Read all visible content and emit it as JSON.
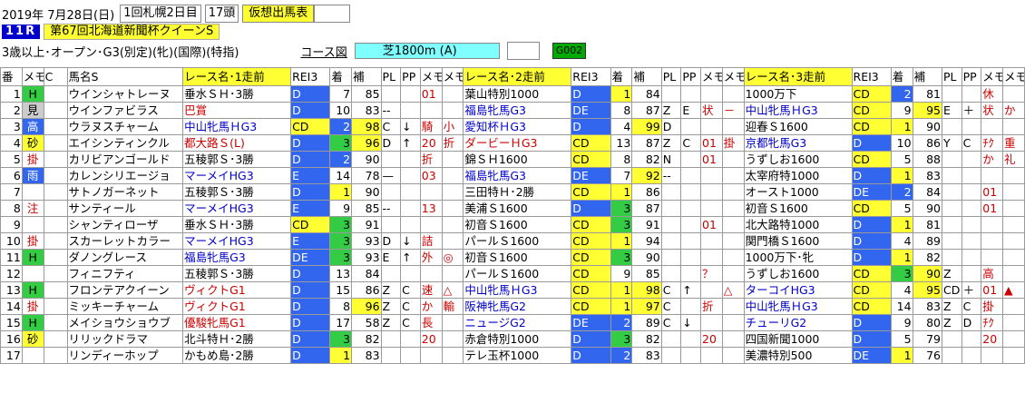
{
  "header": {
    "date": "2019年 7月28日(日)",
    "meet": "1回札幌2日目",
    "runners": "17頭",
    "status_label": "仮想出馬表",
    "race_no": "11R",
    "race_name": "第67回北海道新聞杯クイーンS",
    "conditions": "3歳以上･オープン･G3(別定)(牝)(国際)(特指)",
    "course_label": "コース図",
    "course": "芝1800m (A)",
    "code": "G002"
  },
  "columns": {
    "num": "番",
    "memo": "メモ",
    "c": "C",
    "name": "馬名S",
    "race1": "レース名･1走前",
    "rank3": "REI3",
    "place": "着",
    "supp": "補",
    "pl": "PL",
    "pp": "PP",
    "race2": "レース名･2走前",
    "race3": "レース名･3走前"
  },
  "rows": [
    {
      "no": "1",
      "mark": "H",
      "mc": "grn",
      "name": "ウインシャトレーヌ",
      "r1": "垂水ＳＨ･3勝",
      "r1c": "",
      "g1": "D",
      "g1c": "blue",
      "p1": "7",
      "p1c": "",
      "s1": "85",
      "s1c": "",
      "pl1": "",
      "pp1": "",
      "m1a": "01",
      "m1b": "",
      "r2": "葉山特別1000",
      "r2c": "",
      "g2": "D",
      "g2c": "blue",
      "p2": "1",
      "p2c": "yel",
      "s2": "84",
      "s2c": "",
      "pl2": "",
      "pp2": "",
      "m2a": "",
      "m2b": "",
      "r3": "1000万下",
      "r3c": "",
      "g3": "CD",
      "g3c": "yel",
      "p3": "2",
      "p3c": "blue",
      "s3": "81",
      "s3c": "",
      "pl3": "",
      "pp3": "",
      "m3a": "休",
      "m3b": ""
    },
    {
      "no": "2",
      "mark": "見",
      "mc": "gray",
      "name": "ウインファビラス",
      "r1": "巴賞",
      "r1c": "red",
      "g1": "D",
      "g1c": "blue",
      "p1": "10",
      "p1c": "",
      "s1": "83",
      "s1c": "",
      "pl1": "--",
      "pp1": "",
      "m1a": "",
      "m1b": "",
      "r2": "福島牝馬G3",
      "r2c": "dblue",
      "g2": "DE",
      "g2c": "blue",
      "p2": "8",
      "p2c": "",
      "s2": "87",
      "s2c": "",
      "pl2": "Z",
      "pp2": "E",
      "m2a": "状",
      "m2b": "－",
      "r3": "中山牝馬ＨG3",
      "r3c": "dblue",
      "g3": "CD",
      "g3c": "yel",
      "p3": "9",
      "p3c": "",
      "s3": "95",
      "s3c": "yel",
      "pl3": "E",
      "pp3": "＋",
      "m3a": "状",
      "m3b": "か"
    },
    {
      "no": "3",
      "mark": "高",
      "mc": "blue",
      "name": "ウラヌスチャーム",
      "r1": "中山牝馬ＨG3",
      "r1c": "dblue",
      "g1": "CD",
      "g1c": "yel",
      "p1": "2",
      "p1c": "blue",
      "s1": "98",
      "s1c": "yel",
      "pl1": "C",
      "pp1": "↓",
      "m1a": "騎",
      "m1b": "小",
      "r2": "愛知杯ＨG3",
      "r2c": "dblue",
      "g2": "D",
      "g2c": "blue",
      "p2": "4",
      "p2c": "",
      "s2": "99",
      "s2c": "yel",
      "pl2": "D",
      "pp2": "",
      "m2a": "",
      "m2b": "",
      "r3": "迎春Ｓ1600",
      "r3c": "",
      "g3": "CD",
      "g3c": "yel",
      "p3": "1",
      "p3c": "yel",
      "s3": "90",
      "s3c": "",
      "pl3": "",
      "pp3": "",
      "m3a": "",
      "m3b": ""
    },
    {
      "no": "4",
      "mark": "砂",
      "mc": "yel",
      "name": "エイシンティンクル",
      "r1": "都大路Ｓ(L)",
      "r1c": "red",
      "g1": "D",
      "g1c": "blue",
      "p1": "3",
      "p1c": "grn",
      "s1": "96",
      "s1c": "yel",
      "pl1": "D",
      "pp1": "↑",
      "m1a": "20",
      "m1b": "折",
      "r2": "ダービーＨG3",
      "r2c": "red",
      "g2": "CD",
      "g2c": "yel",
      "p2": "13",
      "p2c": "",
      "s2": "87",
      "s2c": "",
      "pl2": "Z",
      "pp2": "C",
      "m2a": "01",
      "m2b": "掛",
      "r3": "京都牝馬G3",
      "r3c": "dblue",
      "g3": "D",
      "g3c": "blue",
      "p3": "10",
      "p3c": "",
      "s3": "86",
      "s3c": "",
      "pl3": "Y",
      "pp3": "C",
      "m3a": "ﾁｸ",
      "m3b": "重"
    },
    {
      "no": "5",
      "mark": "掛",
      "mc": "red",
      "name": "カリビアンゴールド",
      "r1": "五稜郭Ｓ･3勝",
      "r1c": "",
      "g1": "D",
      "g1c": "blue",
      "p1": "2",
      "p1c": "blue",
      "s1": "90",
      "s1c": "",
      "pl1": "",
      "pp1": "",
      "m1a": "折",
      "m1b": "",
      "r2": "錦ＳＨ1600",
      "r2c": "",
      "g2": "CD",
      "g2c": "yel",
      "p2": "8",
      "p2c": "",
      "s2": "82",
      "s2c": "",
      "pl2": "N",
      "pp2": "",
      "m2a": "01",
      "m2b": "",
      "r3": "うずしお1600",
      "r3c": "",
      "g3": "CD",
      "g3c": "yel",
      "p3": "5",
      "p3c": "",
      "s3": "88",
      "s3c": "",
      "pl3": "",
      "pp3": "",
      "m3a": "か",
      "m3b": "礼"
    },
    {
      "no": "6",
      "mark": "雨",
      "mc": "blue",
      "name": "カレンシリエージョ",
      "r1": "マーメイHG3",
      "r1c": "dblue",
      "g1": "E",
      "g1c": "blue",
      "p1": "14",
      "p1c": "",
      "s1": "78",
      "s1c": "",
      "pl1": "—",
      "pp1": "",
      "m1a": "03",
      "m1b": "",
      "r2": "福島牝馬G3",
      "r2c": "dblue",
      "g2": "DE",
      "g2c": "blue",
      "p2": "7",
      "p2c": "",
      "s2": "92",
      "s2c": "yel",
      "pl2": "--",
      "pp2": "",
      "m2a": "",
      "m2b": "",
      "r3": "太宰府特1000",
      "r3c": "",
      "g3": "D",
      "g3c": "blue",
      "p3": "1",
      "p3c": "yel",
      "s3": "83",
      "s3c": "",
      "pl3": "",
      "pp3": "",
      "m3a": "",
      "m3b": ""
    },
    {
      "no": "7",
      "mark": "",
      "mc": "",
      "name": "サトノガーネット",
      "r1": "五稜郭Ｓ･3勝",
      "r1c": "",
      "g1": "D",
      "g1c": "blue",
      "p1": "1",
      "p1c": "yel",
      "s1": "90",
      "s1c": "",
      "pl1": "",
      "pp1": "",
      "m1a": "",
      "m1b": "",
      "r2": "三田特Ｈ･2勝",
      "r2c": "",
      "g2": "CD",
      "g2c": "yel",
      "p2": "1",
      "p2c": "yel",
      "s2": "86",
      "s2c": "",
      "pl2": "",
      "pp2": "",
      "m2a": "",
      "m2b": "",
      "r3": "オースト1000",
      "r3c": "",
      "g3": "DE",
      "g3c": "blue",
      "p3": "2",
      "p3c": "blue",
      "s3": "84",
      "s3c": "",
      "pl3": "",
      "pp3": "",
      "m3a": "01",
      "m3b": ""
    },
    {
      "no": "8",
      "mark": "注",
      "mc": "red",
      "name": "サンティール",
      "r1": "マーメイHG3",
      "r1c": "dblue",
      "g1": "E",
      "g1c": "blue",
      "p1": "9",
      "p1c": "",
      "s1": "85",
      "s1c": "",
      "pl1": "--",
      "pp1": "",
      "m1a": "13",
      "m1b": "",
      "r2": "美浦Ｓ1600",
      "r2c": "",
      "g2": "D",
      "g2c": "blue",
      "p2": "3",
      "p2c": "grn",
      "s2": "87",
      "s2c": "",
      "pl2": "",
      "pp2": "",
      "m2a": "",
      "m2b": "",
      "r3": "初音Ｓ1600",
      "r3c": "",
      "g3": "CD",
      "g3c": "yel",
      "p3": "5",
      "p3c": "",
      "s3": "90",
      "s3c": "",
      "pl3": "",
      "pp3": "",
      "m3a": "01",
      "m3b": ""
    },
    {
      "no": "9",
      "mark": "",
      "mc": "",
      "name": "シャンティローザ",
      "r1": "垂水ＳＨ･3勝",
      "r1c": "",
      "g1": "CD",
      "g1c": "yel",
      "p1": "3",
      "p1c": "grn",
      "s1": "91",
      "s1c": "",
      "pl1": "",
      "pp1": "",
      "m1a": "",
      "m1b": "",
      "r2": "初音Ｓ1600",
      "r2c": "",
      "g2": "CD",
      "g2c": "yel",
      "p2": "3",
      "p2c": "grn",
      "s2": "91",
      "s2c": "",
      "pl2": "",
      "pp2": "",
      "m2a": "01",
      "m2b": "",
      "r3": "北大路特1000",
      "r3c": "",
      "g3": "D",
      "g3c": "blue",
      "p3": "1",
      "p3c": "yel",
      "s3": "81",
      "s3c": "",
      "pl3": "",
      "pp3": "",
      "m3a": "",
      "m3b": ""
    },
    {
      "no": "10",
      "mark": "掛",
      "mc": "red",
      "name": "スカーレットカラー",
      "r1": "マーメイHG3",
      "r1c": "dblue",
      "g1": "E",
      "g1c": "blue",
      "p1": "3",
      "p1c": "grn",
      "s1": "93",
      "s1c": "",
      "pl1": "D",
      "pp1": "↓",
      "m1a": "詰",
      "m1b": "",
      "r2": "パールＳ1600",
      "r2c": "",
      "g2": "CD",
      "g2c": "yel",
      "p2": "1",
      "p2c": "yel",
      "s2": "94",
      "s2c": "",
      "pl2": "",
      "pp2": "",
      "m2a": "",
      "m2b": "",
      "r3": "関門橋Ｓ1600",
      "r3c": "",
      "g3": "D",
      "g3c": "blue",
      "p3": "4",
      "p3c": "",
      "s3": "89",
      "s3c": "",
      "pl3": "",
      "pp3": "",
      "m3a": "",
      "m3b": ""
    },
    {
      "no": "11",
      "mark": "H",
      "mc": "grn",
      "name": "ダノングレース",
      "r1": "福島牝馬G3",
      "r1c": "dblue",
      "g1": "DE",
      "g1c": "blue",
      "p1": "3",
      "p1c": "grn",
      "s1": "93",
      "s1c": "",
      "pl1": "E",
      "pp1": "↑",
      "m1a": "外",
      "m1b": "◎",
      "r2": "初音Ｓ1600",
      "r2c": "",
      "g2": "CD",
      "g2c": "yel",
      "p2": "3",
      "p2c": "grn",
      "s2": "90",
      "s2c": "",
      "pl2": "",
      "pp2": "",
      "m2a": "",
      "m2b": "",
      "r3": "1000万下･牝",
      "r3c": "",
      "g3": "D",
      "g3c": "blue",
      "p3": "1",
      "p3c": "yel",
      "s3": "82",
      "s3c": "",
      "pl3": "",
      "pp3": "",
      "m3a": "",
      "m3b": ""
    },
    {
      "no": "12",
      "mark": "",
      "mc": "",
      "name": "フィニフティ",
      "r1": "五稜郭Ｓ･3勝",
      "r1c": "",
      "g1": "D",
      "g1c": "blue",
      "p1": "13",
      "p1c": "",
      "s1": "84",
      "s1c": "",
      "pl1": "",
      "pp1": "",
      "m1a": "",
      "m1b": "",
      "r2": "パールＳ1600",
      "r2c": "",
      "g2": "CD",
      "g2c": "yel",
      "p2": "9",
      "p2c": "",
      "s2": "85",
      "s2c": "",
      "pl2": "",
      "pp2": "",
      "m2a": "？",
      "m2b": "",
      "r3": "うずしお1600",
      "r3c": "",
      "g3": "CD",
      "g3c": "yel",
      "p3": "3",
      "p3c": "grn",
      "s3": "90",
      "s3c": "yel",
      "pl3": "Z",
      "pp3": "",
      "m3a": "高",
      "m3b": ""
    },
    {
      "no": "13",
      "mark": "H",
      "mc": "grn",
      "name": "フロンテアクイーン",
      "r1": "ヴィクトG1",
      "r1c": "red",
      "g1": "D",
      "g1c": "blue",
      "p1": "15",
      "p1c": "",
      "s1": "86",
      "s1c": "",
      "pl1": "Z",
      "pp1": "C",
      "m1a": "速",
      "m1b": "△",
      "r2": "中山牝馬ＨG3",
      "r2c": "dblue",
      "g2": "CD",
      "g2c": "yel",
      "p2": "1",
      "p2c": "yel",
      "s2": "98",
      "s2c": "yel",
      "pl2": "C",
      "pp2": "↑",
      "m2a": "",
      "m2b": "△",
      "r3": "ターコイHG3",
      "r3c": "dblue",
      "g3": "CD",
      "g3c": "yel",
      "p3": "4",
      "p3c": "",
      "s3": "95",
      "s3c": "yel",
      "pl3": "CD",
      "pp3": "＋",
      "m3a": "01",
      "m3b": "▲"
    },
    {
      "no": "14",
      "mark": "掛",
      "mc": "red",
      "name": "ミッキーチャーム",
      "r1": "ヴィクトG1",
      "r1c": "red",
      "g1": "D",
      "g1c": "blue",
      "p1": "8",
      "p1c": "",
      "s1": "96",
      "s1c": "yel",
      "pl1": "Z",
      "pp1": "C",
      "m1a": "か",
      "m1b": "輸",
      "r2": "阪神牝馬G2",
      "r2c": "dblue",
      "g2": "CD",
      "g2c": "yel",
      "p2": "1",
      "p2c": "yel",
      "s2": "97",
      "s2c": "yel",
      "pl2": "C",
      "pp2": "",
      "m2a": "折",
      "m2b": "",
      "r3": "中山牝馬ＨG3",
      "r3c": "dblue",
      "g3": "CD",
      "g3c": "yel",
      "p3": "14",
      "p3c": "",
      "s3": "83",
      "s3c": "",
      "pl3": "Z",
      "pp3": "C",
      "m3a": "掛",
      "m3b": ""
    },
    {
      "no": "15",
      "mark": "H",
      "mc": "grn",
      "name": "メイショウショウブ",
      "r1": "優駿牝馬G1",
      "r1c": "red",
      "g1": "D",
      "g1c": "blue",
      "p1": "17",
      "p1c": "",
      "s1": "58",
      "s1c": "",
      "pl1": "Z",
      "pp1": "C",
      "m1a": "長",
      "m1b": "",
      "r2": "ニュージG2",
      "r2c": "dblue",
      "g2": "DE",
      "g2c": "blue",
      "p2": "2",
      "p2c": "blue",
      "s2": "89",
      "s2c": "",
      "pl2": "C",
      "pp2": "↓",
      "m2a": "",
      "m2b": "",
      "r3": "チューリG2",
      "r3c": "dblue",
      "g3": "D",
      "g3c": "blue",
      "p3": "9",
      "p3c": "",
      "s3": "80",
      "s3c": "",
      "pl3": "Z",
      "pp3": "D",
      "m3a": "ﾁｸ",
      "m3b": ""
    },
    {
      "no": "16",
      "mark": "砂",
      "mc": "yel",
      "name": "リリックドラマ",
      "r1": "北斗特Ｈ･2勝",
      "r1c": "",
      "g1": "D",
      "g1c": "blue",
      "p1": "3",
      "p1c": "grn",
      "s1": "82",
      "s1c": "",
      "pl1": "",
      "pp1": "",
      "m1a": "20",
      "m1b": "",
      "r2": "赤倉特別1000",
      "r2c": "",
      "g2": "D",
      "g2c": "blue",
      "p2": "3",
      "p2c": "grn",
      "s2": "82",
      "s2c": "",
      "pl2": "",
      "pp2": "",
      "m2a": "20",
      "m2b": "",
      "r3": "四国新聞1000",
      "r3c": "",
      "g3": "D",
      "g3c": "blue",
      "p3": "5",
      "p3c": "",
      "s3": "79",
      "s3c": "",
      "pl3": "",
      "pp3": "",
      "m3a": "20",
      "m3b": ""
    },
    {
      "no": "17",
      "mark": "",
      "mc": "",
      "name": "リンディーホップ",
      "r1": "かもめ島･2勝",
      "r1c": "",
      "g1": "D",
      "g1c": "blue",
      "p1": "1",
      "p1c": "yel",
      "s1": "83",
      "s1c": "",
      "pl1": "",
      "pp1": "",
      "m1a": "",
      "m1b": "",
      "r2": "テレ玉杯1000",
      "r2c": "",
      "g2": "D",
      "g2c": "blue",
      "p2": "2",
      "p2c": "blue",
      "s2": "83",
      "s2c": "",
      "pl2": "",
      "pp2": "",
      "m2a": "",
      "m2b": "",
      "r3": "美濃特別500",
      "r3c": "",
      "g3": "DE",
      "g3c": "blue",
      "p3": "1",
      "p3c": "yel",
      "s3": "76",
      "s3c": "",
      "pl3": "",
      "pp3": "",
      "m3a": "",
      "m3b": ""
    }
  ]
}
